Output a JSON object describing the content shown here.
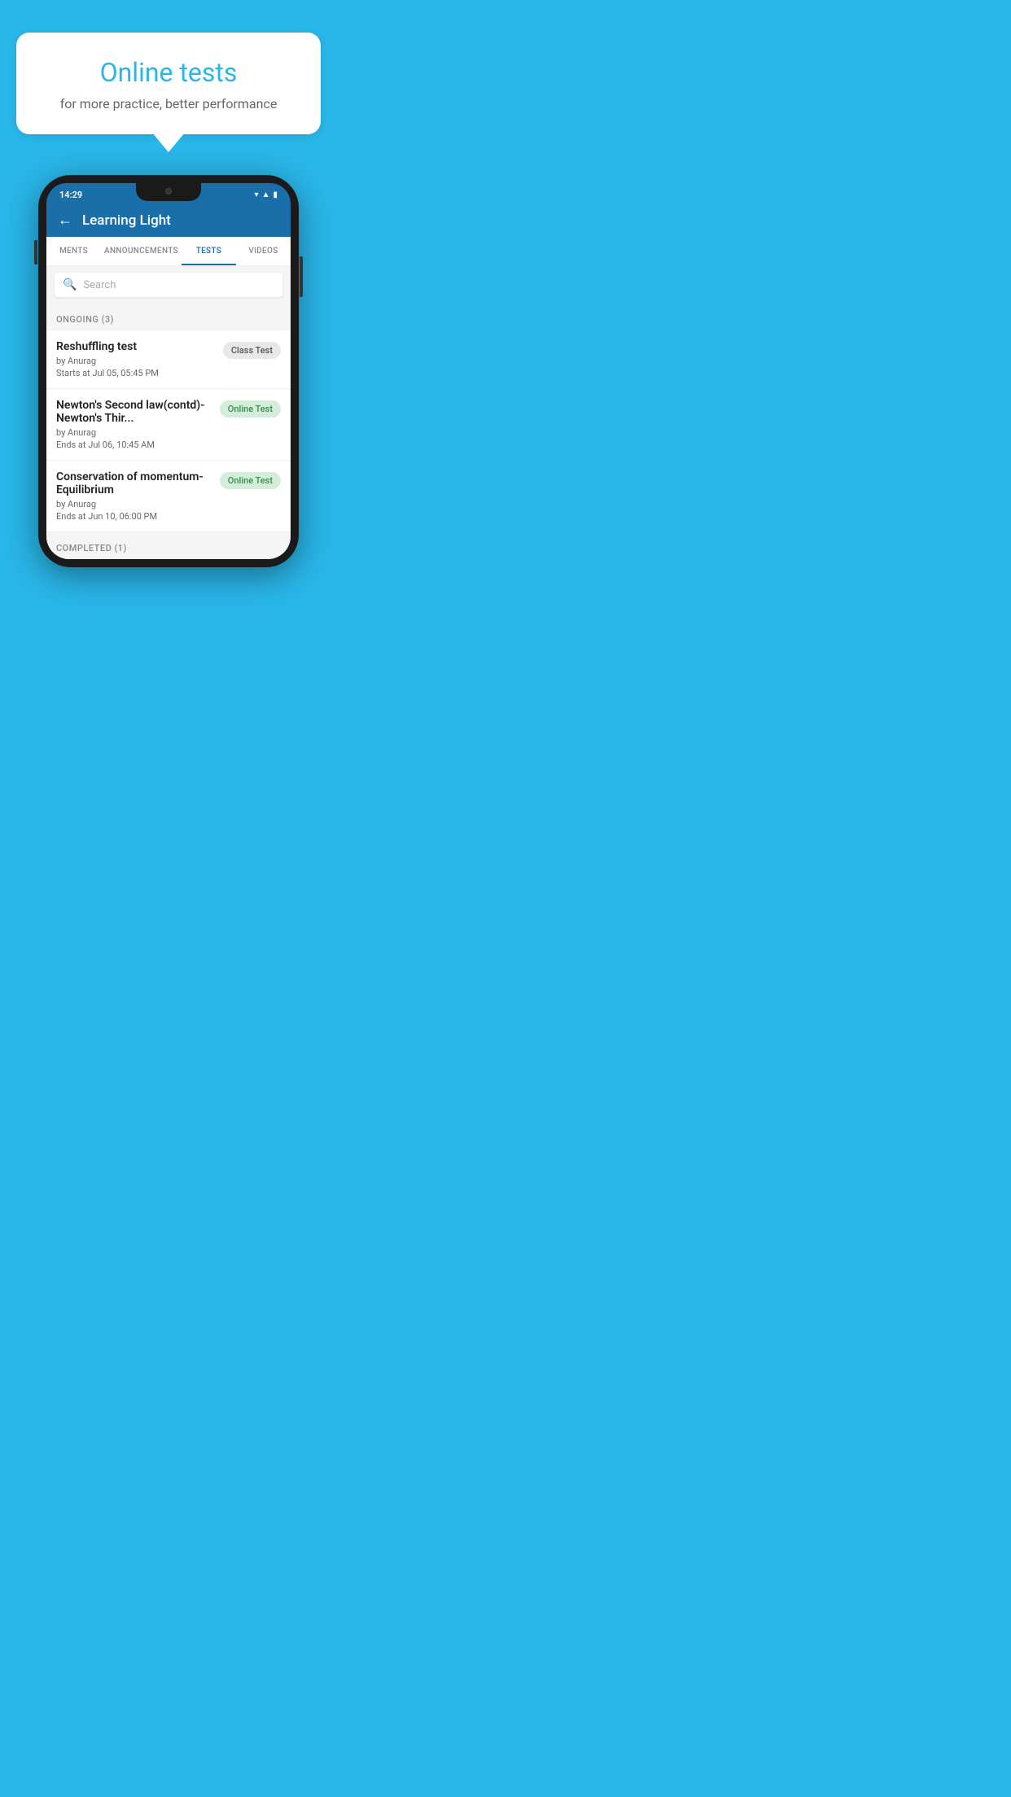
{
  "background": {
    "color": "#29b6e8"
  },
  "speech_bubble": {
    "title": "Online tests",
    "subtitle": "for more practice, better performance"
  },
  "phone": {
    "status_bar": {
      "time": "14:29",
      "icons": [
        "wifi",
        "signal",
        "battery"
      ]
    },
    "app_bar": {
      "title": "Learning Light",
      "back_label": "←"
    },
    "tabs": [
      {
        "label": "MENTS",
        "active": false
      },
      {
        "label": "ANNOUNCEMENTS",
        "active": false
      },
      {
        "label": "TESTS",
        "active": true
      },
      {
        "label": "VIDEOS",
        "active": false
      }
    ],
    "search": {
      "placeholder": "Search"
    },
    "sections": [
      {
        "header": "ONGOING (3)",
        "items": [
          {
            "name": "Reshuffling test",
            "author": "by Anurag",
            "date": "Starts at  Jul 05, 05:45 PM",
            "badge": "Class Test",
            "badge_type": "class"
          },
          {
            "name": "Newton's Second law(contd)-Newton's Thir...",
            "author": "by Anurag",
            "date": "Ends at  Jul 06, 10:45 AM",
            "badge": "Online Test",
            "badge_type": "online"
          },
          {
            "name": "Conservation of momentum-Equilibrium",
            "author": "by Anurag",
            "date": "Ends at  Jun 10, 06:00 PM",
            "badge": "Online Test",
            "badge_type": "online"
          }
        ]
      },
      {
        "header": "COMPLETED (1)",
        "items": []
      }
    ]
  }
}
